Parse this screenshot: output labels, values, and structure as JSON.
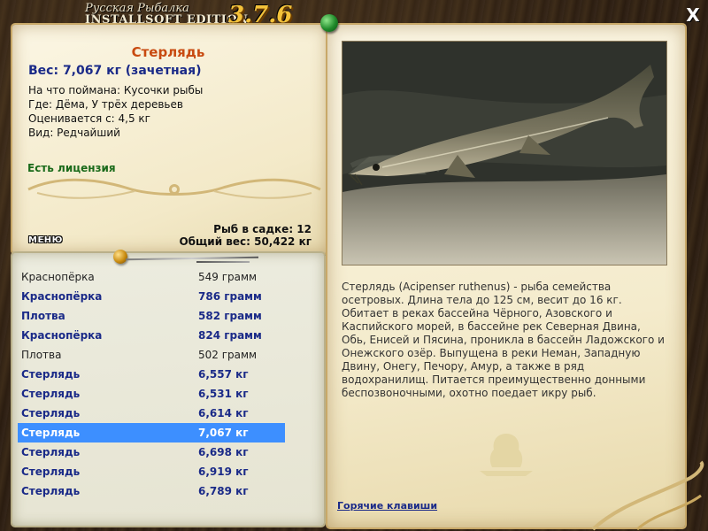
{
  "header": {
    "title_top": "Русская Рыбалка",
    "title_main": "INSTALLSOFT EDITION",
    "version": "3.7.6",
    "close_label": "X"
  },
  "fish": {
    "name": "Стерлядь",
    "weight_line": "Вес: 7,067 кг (зачетная)",
    "caught_on": "На что поймана: Кусочки рыбы",
    "location": "Где: Дёма, У трёх деревьев",
    "valued_from": "Оценивается с: 4,5 кг",
    "rarity": "Вид: Редчайший",
    "license": "Есть лицензия"
  },
  "stats": {
    "fish_in_keepnet": "Рыб в садке: 12",
    "total_weight": "Общий вес: 50,422 кг"
  },
  "menu_label": "МЕНЮ",
  "catch_list": [
    {
      "name": "Краснопёрка",
      "weight": "549 грамм",
      "style": "normal"
    },
    {
      "name": "Краснопёрка",
      "weight": "786 грамм",
      "style": "bold"
    },
    {
      "name": "Плотва",
      "weight": "582 грамм",
      "style": "bold"
    },
    {
      "name": "Краснопёрка",
      "weight": "824 грамм",
      "style": "bold"
    },
    {
      "name": "Плотва",
      "weight": "502 грамм",
      "style": "normal"
    },
    {
      "name": "Стерлядь",
      "weight": "6,557 кг",
      "style": "bold"
    },
    {
      "name": "Стерлядь",
      "weight": "6,531 кг",
      "style": "bold"
    },
    {
      "name": "Стерлядь",
      "weight": "6,614 кг",
      "style": "bold"
    },
    {
      "name": "Стерлядь",
      "weight": "7,067 кг",
      "style": "selected"
    },
    {
      "name": "Стерлядь",
      "weight": "6,698 кг",
      "style": "bold"
    },
    {
      "name": "Стерлядь",
      "weight": "6,919 кг",
      "style": "bold"
    },
    {
      "name": "Стерлядь",
      "weight": "6,789 кг",
      "style": "bold"
    }
  ],
  "description": "Стерлядь (Acipenser ruthenus) - рыба семейства осетровых. Длина тела до 125 см, весит до 16 кг. Обитает в реках бассейна Чёрного, Азовского и Каспийского морей, в бассейне рек Северная Двина, Обь, Енисей и Пясина, проникла в бассейн Ладожского и Онежского озёр. Выпущена в реки Неман, Западную Двину, Онегу, Печору, Амур, а также в ряд водохранилищ. Питается преимущественно донными беспозвоночными, охотно поедает икру рыб.",
  "hotkeys_label": "Горячие клавиши",
  "colors": {
    "fish_name": "#c84a10",
    "weight": "#1a2a88",
    "license": "#1a6a1a",
    "selected_row": "#3d8fff",
    "version": "#f4c23a"
  }
}
